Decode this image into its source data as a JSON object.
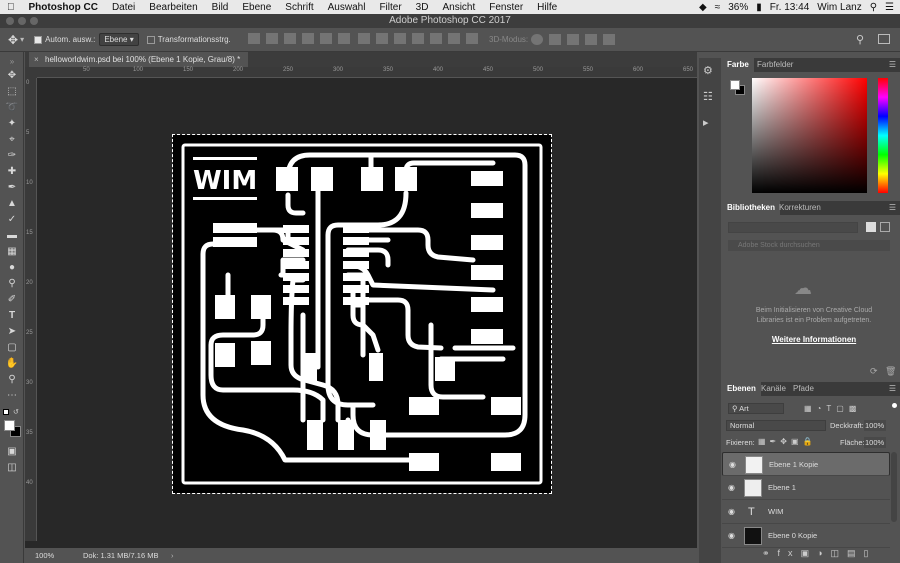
{
  "menubar": {
    "app": "Photoshop CC",
    "items": [
      "Datei",
      "Bearbeiten",
      "Bild",
      "Ebene",
      "Schrift",
      "Auswahl",
      "Filter",
      "3D",
      "Ansicht",
      "Fenster",
      "Hilfe"
    ],
    "battery": "36%",
    "clock": "Fr. 13:44",
    "user": "Wim Lanz"
  },
  "window": {
    "title": "Adobe Photoshop CC 2017"
  },
  "options": {
    "auto_select_label": "Autom. ausw.:",
    "auto_select_value": "Ebene",
    "transform_label": "Transformationsstrg.",
    "mode3d_label": "3D-Modus:"
  },
  "document": {
    "tab_title": "helloworldwim.psd bei 100% (Ebene 1 Kopie, Grau/8) *",
    "zoom": "100%",
    "doc_info": "Dok: 1.31 MB/7.16 MB",
    "canvas_logo": "WIM",
    "ruler_top": [
      "0",
      "50",
      "100",
      "150",
      "200",
      "250",
      "300",
      "350",
      "400",
      "450",
      "500",
      "550",
      "600",
      "650"
    ],
    "ruler_left": [
      "0",
      "5",
      "10",
      "15",
      "20",
      "25",
      "30",
      "35",
      "40"
    ]
  },
  "color_panel": {
    "tabs": [
      "Farbe",
      "Farbfelder"
    ]
  },
  "libraries_panel": {
    "tabs": [
      "Bibliotheken",
      "Korrekturen"
    ],
    "search_placeholder": "Adobe Stock durchsuchen",
    "error_text": "Beim Initialisieren von Creative Cloud Libraries ist ein Problem aufgetreten.",
    "more_info": "Weitere Informationen"
  },
  "layers_panel": {
    "tabs": [
      "Ebenen",
      "Kanäle",
      "Pfade"
    ],
    "filter_label": "Art",
    "blend_mode": "Normal",
    "opacity_label": "Deckkraft:",
    "opacity_value": "100%",
    "lock_label": "Fixieren:",
    "fill_label": "Fläche:",
    "fill_value": "100%",
    "layers": [
      {
        "name": "Ebene 1 Kopie",
        "type": "pixel",
        "selected": true
      },
      {
        "name": "Ebene 1",
        "type": "pixel",
        "selected": false
      },
      {
        "name": "WIM",
        "type": "text",
        "selected": false
      },
      {
        "name": "Ebene 0 Kopie",
        "type": "pixel",
        "selected": false
      }
    ]
  },
  "tools": [
    "move",
    "marquee",
    "lasso",
    "quick-select",
    "crop",
    "eyedropper",
    "healing",
    "brush",
    "clone-stamp",
    "history-brush",
    "eraser",
    "gradient",
    "blur",
    "dodge",
    "pen",
    "type",
    "path-select",
    "shape",
    "hand",
    "zoom",
    "more"
  ]
}
